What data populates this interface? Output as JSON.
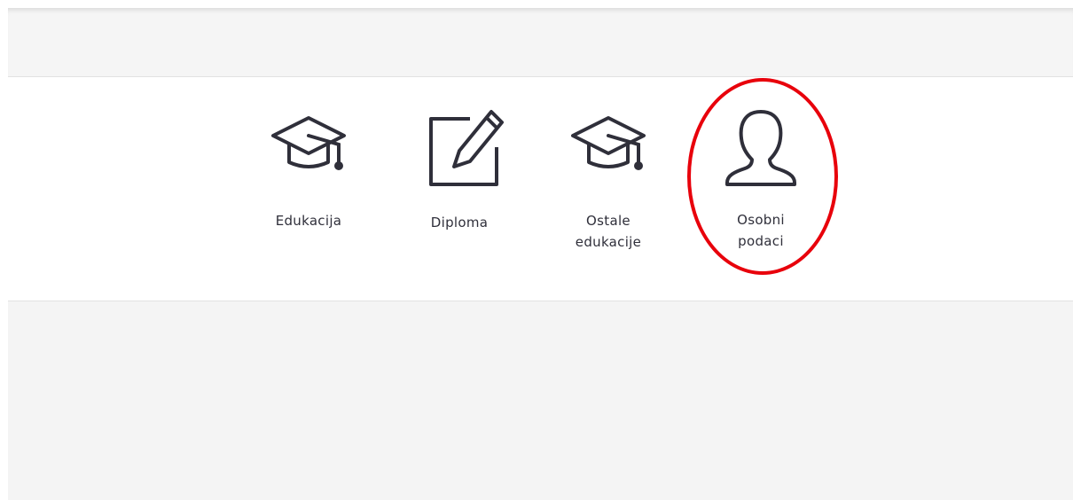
{
  "menu": {
    "items": [
      {
        "label": "Edukacija",
        "icon": "graduation-cap-icon"
      },
      {
        "label": "Diploma",
        "icon": "edit-icon"
      },
      {
        "label": "Ostale\nedukacije",
        "icon": "graduation-cap-icon"
      },
      {
        "label": "Osobni\npodaci",
        "icon": "user-icon"
      }
    ]
  },
  "colors": {
    "icon": "#2f2f3a",
    "highlight": "#e8000b",
    "band": "#f4f4f4"
  }
}
